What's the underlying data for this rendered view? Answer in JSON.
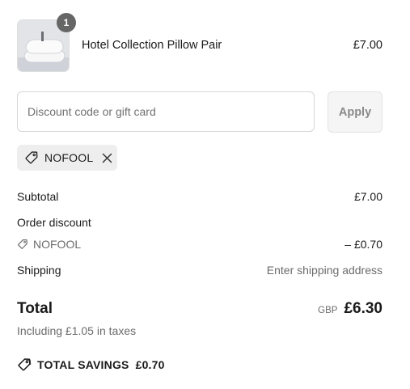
{
  "line_item": {
    "quantity": "1",
    "name": "Hotel Collection Pillow Pair",
    "price": "£7.00",
    "image_icon": "pillow-product-image"
  },
  "discount": {
    "placeholder": "Discount code or gift card",
    "value": "",
    "apply_label": "Apply",
    "applied_code": "NOFOOL"
  },
  "summary": {
    "subtotal_label": "Subtotal",
    "subtotal_value": "£7.00",
    "order_discount_label": "Order discount",
    "discount_code": "NOFOOL",
    "discount_value": "– £0.70",
    "shipping_label": "Shipping",
    "shipping_value": "Enter shipping address",
    "total_label": "Total",
    "currency": "GBP",
    "total_value": "£6.30",
    "taxes_note": "Including £1.05 in taxes",
    "savings_label": "TOTAL SAVINGS",
    "savings_value": "£0.70"
  },
  "colors": {
    "badge": "#666666",
    "muted_text": "#6b6b6b",
    "chip_bg": "#eeeeee",
    "apply_bg": "#f5f5f5"
  }
}
